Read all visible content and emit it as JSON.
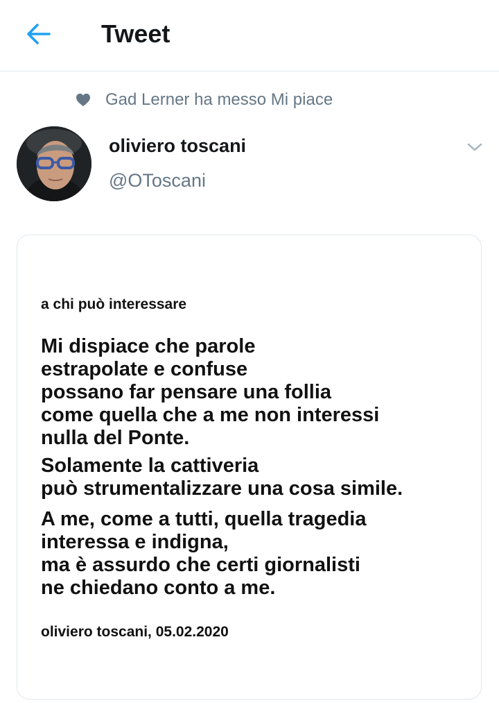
{
  "header": {
    "title": "Tweet",
    "back_icon": "arrow-left-icon",
    "accent_color": "#1da1f2"
  },
  "social_context": {
    "icon": "heart-icon",
    "text": "Gad Lerner ha messo Mi piace"
  },
  "tweet": {
    "user_name": "oliviero toscani",
    "user_handle": "@OToscani",
    "menu_icon": "chevron-down-icon",
    "media": {
      "heading": "a chi può interessare",
      "paragraph1": [
        "Mi dispiace che parole",
        "estrapolate e confuse",
        "possano far pensare una follia",
        "come quella che a me non interessi",
        "nulla del Ponte."
      ],
      "paragraph2": [
        "Solamente la cattiveria",
        "può strumentalizzare una cosa simile."
      ],
      "paragraph3": [
        "A me, come a tutti, quella tragedia",
        "interessa e indigna,",
        "ma è assurdo che certi giornalisti",
        "ne chiedano conto a me."
      ],
      "signature": "oliviero toscani, 05.02.2020"
    }
  }
}
